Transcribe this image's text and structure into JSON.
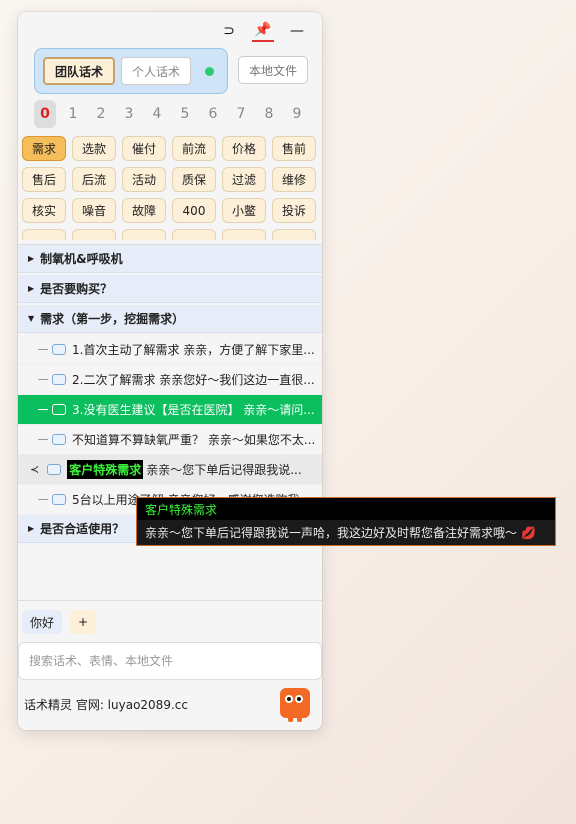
{
  "window": {
    "controls": [
      {
        "name": "return",
        "glyph": "⊃"
      },
      {
        "name": "pin",
        "glyph": "📌"
      },
      {
        "name": "minimize",
        "glyph": "—"
      }
    ]
  },
  "mode": {
    "team": "团队话术",
    "personal": "个人话术",
    "local_file": "本地文件",
    "status_color": "#2ecc71"
  },
  "number_tabs": [
    "0",
    "1",
    "2",
    "3",
    "4",
    "5",
    "6",
    "7",
    "8",
    "9"
  ],
  "categories": [
    [
      "需求",
      "选款",
      "催付",
      "前流",
      "价格",
      "售前"
    ],
    [
      "售后",
      "后流",
      "活动",
      "质保",
      "过滤",
      "维修"
    ],
    [
      "核实",
      "噪音",
      "故障",
      "400",
      "小鳖",
      "投诉"
    ],
    [
      "",
      "",
      "",
      "",
      "",
      ""
    ]
  ],
  "tree": {
    "group1": "制氧机&呼吸机",
    "group2": "是否要购买？",
    "group3": "需求（第一步，挖掘需求）",
    "items": [
      "1.首次主动了解需求 亲亲，方便了解下家里...",
      "2.二次了解需求 亲亲您好～我们这边一直很...",
      "3.没有医生建议【是否在医院】 亲亲～请问...",
      "不知道算不算缺氧严重？ 亲亲～如果您不太...",
      "",
      "5台以上用途了解 亲亲您好，感谢您选购我..."
    ],
    "hover_tag": "客户特殊需求",
    "hover_text": "亲亲～您下单后记得跟我说...",
    "group4": "是否合适使用？"
  },
  "quick": {
    "preset": "你好",
    "add": "+"
  },
  "search": {
    "placeholder": "搜索话术、表情、本地文件"
  },
  "footer": {
    "text": "话术精灵 官网: luyao2089.cc"
  },
  "tooltip": {
    "title": "客户特殊需求",
    "body": "亲亲～您下单后记得跟我说一声哈，我这边好及时帮您备注好需求哦～"
  }
}
